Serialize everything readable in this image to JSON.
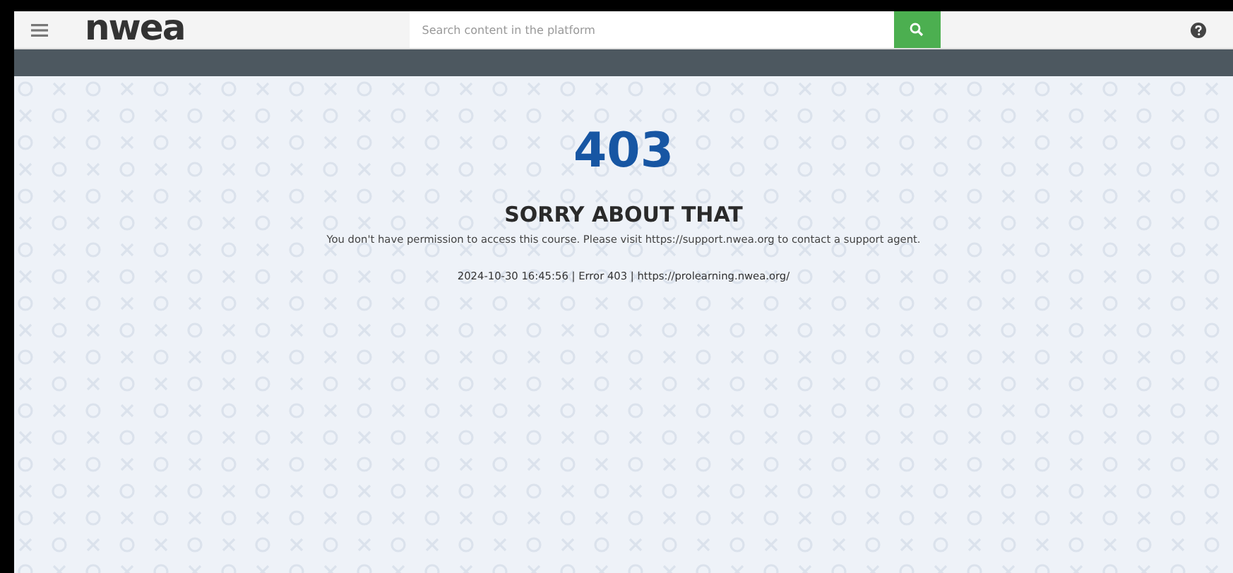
{
  "header": {
    "logo": "nwea",
    "search": {
      "placeholder": "Search content in the platform"
    }
  },
  "error": {
    "code": "403",
    "title": "SORRY ABOUT THAT",
    "message": "You don't have permission to access this course. Please visit https://support.nwea.org to contact a support agent.",
    "details": "2024-10-30 16:45:56 | Error 403 | https://prolearning.nwea.org/"
  }
}
